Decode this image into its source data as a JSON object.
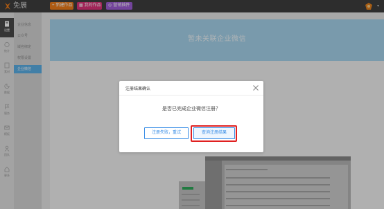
{
  "app": {
    "logo_text": "免展",
    "brand_color": "#f07d1a"
  },
  "topbar": {
    "create_label": "新建作品",
    "works_label": "我的作品",
    "plugin_label": "营销插件"
  },
  "sidebar": {
    "items": [
      {
        "label": "设置",
        "icon": "document-icon"
      },
      {
        "label": "统计",
        "icon": "globe-icon"
      },
      {
        "label": "素材",
        "icon": "grid-icon"
      },
      {
        "label": "数据",
        "icon": "pie-icon"
      },
      {
        "label": "服务",
        "icon": "flag-icon"
      },
      {
        "label": "模板",
        "icon": "mail-icon"
      },
      {
        "label": "团队",
        "icon": "user-icon"
      },
      {
        "label": "更多",
        "icon": "home-icon"
      }
    ]
  },
  "submenu": {
    "items": [
      "企业信息",
      "公众号",
      "域名绑定",
      "权限设置",
      "企业微信"
    ],
    "active_index": 4
  },
  "main": {
    "banner_text": "暂未关联企业微信"
  },
  "dialog": {
    "title": "注册结果确认",
    "question": "是否已完成企业微信注册？",
    "retry_label": "注册失败，重试",
    "query_label": "查询注册结果"
  }
}
